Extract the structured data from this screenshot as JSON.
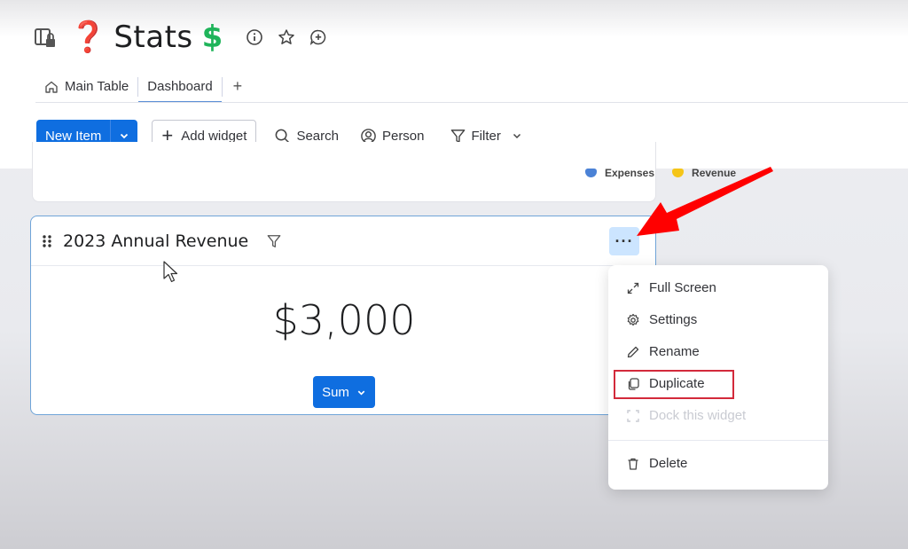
{
  "board": {
    "title_prefix_emoji": "❓",
    "title": "Stats",
    "title_suffix_emoji": "$",
    "actions": [
      "info-icon",
      "star-icon",
      "add-update-icon"
    ]
  },
  "tabs": [
    {
      "label": "Main Table",
      "icon": "home-icon",
      "active": false
    },
    {
      "label": "Dashboard",
      "active": true
    },
    {
      "label": "+"
    }
  ],
  "toolbar": {
    "new_item_label": "New Item",
    "add_widget_label": "Add widget",
    "search_label": "Search",
    "person_label": "Person",
    "filter_label": "Filter"
  },
  "chart_legend": [
    {
      "label": "Expenses",
      "color": "#4b82d6"
    },
    {
      "label": "Revenue",
      "color": "#f5c518"
    }
  ],
  "widget": {
    "title": "2023 Annual Revenue",
    "value": "$3,000",
    "aggregation": "Sum",
    "more_label": "···"
  },
  "context_menu": {
    "items": [
      {
        "label": "Full Screen",
        "icon": "expand-icon",
        "disabled": false
      },
      {
        "label": "Settings",
        "icon": "gear-icon",
        "disabled": false
      },
      {
        "label": "Rename",
        "icon": "pencil-icon",
        "disabled": false
      },
      {
        "label": "Duplicate",
        "icon": "copy-icon",
        "disabled": false,
        "highlighted": true
      },
      {
        "label": "Dock this widget",
        "icon": "dock-icon",
        "disabled": true
      },
      {
        "label": "Delete",
        "icon": "trash-icon",
        "disabled": false
      }
    ]
  },
  "colors": {
    "primary": "#0f6ee0",
    "highlight_box": "#d32a3b",
    "annotation_arrow": "#ff0000"
  }
}
